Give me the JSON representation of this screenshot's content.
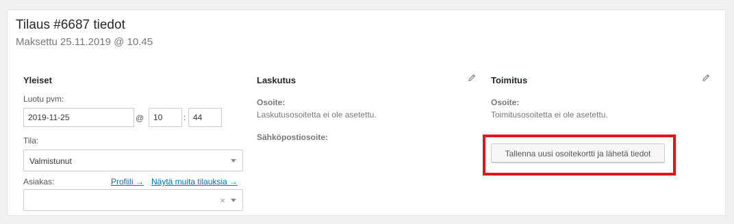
{
  "order": {
    "title": "Tilaus #6687 tiedot",
    "subtitle": "Maksettu 25.11.2019 @ 10.45"
  },
  "general": {
    "heading": "Yleiset",
    "created_label": "Luotu pvm:",
    "date_value": "2019-11-25",
    "at_sign": "@",
    "hour_value": "10",
    "colon": ":",
    "minute_value": "44",
    "status_label": "Tila:",
    "status_value": "Valmistunut",
    "customer_label": "Asiakas:",
    "profile_link": "Profiili →",
    "other_orders_link": "Näytä muita tilauksia →",
    "customer_value": "",
    "clear_symbol": "×"
  },
  "billing": {
    "heading": "Laskutus",
    "address_label": "Osoite:",
    "address_value": "Laskutusosoitetta ei ole asetettu.",
    "email_label": "Sähköpostiosoite:",
    "edit_icon": "pencil-icon"
  },
  "shipping": {
    "heading": "Toimitus",
    "address_label": "Osoite:",
    "address_value": "Toimitusosoitetta ei ole asetettu.",
    "edit_icon": "pencil-icon",
    "save_button_label": "Tallenna uusi osoitekortti ja lähetä tiedot"
  },
  "colors": {
    "highlight": "#e0161e",
    "link": "#0073aa"
  }
}
